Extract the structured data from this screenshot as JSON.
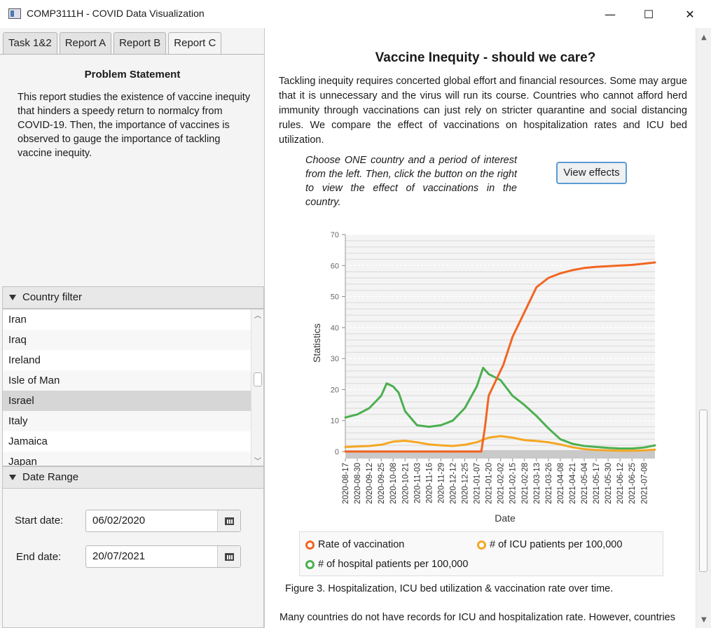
{
  "window": {
    "title": "COMP3111H - COVID Data Visualization",
    "minimize_glyph": "—",
    "maximize_glyph": "☐",
    "close_glyph": "✕"
  },
  "tabs": [
    "Task 1&2",
    "Report A",
    "Report B",
    "Report C"
  ],
  "active_tab": "Report C",
  "left": {
    "problem_title": "Problem Statement",
    "problem_text": "This report studies the existence of vaccine inequity that hinders a speedy return to normalcy from COVID-19. Then, the importance of vaccines is observed to gauge the importance of tackling vaccine inequity.",
    "country_filter": {
      "title": "Country filter",
      "items": [
        "Iran",
        "Iraq",
        "Ireland",
        "Isle of Man",
        "Israel",
        "Italy",
        "Jamaica",
        "Japan"
      ],
      "selected": "Israel"
    },
    "date_range": {
      "title": "Date Range",
      "start_label": "Start date:",
      "start_value": "06/02/2020",
      "end_label": "End date:",
      "end_value": "20/07/2021"
    }
  },
  "right": {
    "title": "Vaccine Inequity - should we care?",
    "paragraph": "Tackling inequity requires concerted global effort and financial resources. Some may argue that it is unnecessary and the virus will run its course. Countries who cannot afford herd immunity through vaccinations can just rely on stricter quarantine and social distancing rules. We compare the effect of vaccinations on hospitalization rates and ICU bed utilization.",
    "instruction": "Choose ONE country and a period of interest from the left. Then, click the button on the right to view the effect of vaccinations in the country.",
    "button_label": "View effects",
    "caption": "Figure 3. Hospitalization, ICU bed utilization & vaccination rate over time.",
    "bottom_text": "Many countries do not have records for ICU and hospitalization rate. However, countries"
  },
  "chart_data": {
    "type": "line",
    "xlabel": "Date",
    "ylabel": "Statistics",
    "ylim": [
      0,
      70
    ],
    "yticks": [
      0,
      10,
      20,
      30,
      40,
      50,
      60,
      70
    ],
    "grid": true,
    "legend_position": "bottom",
    "x_tick_labels": [
      "2020-08-17",
      "2020-08-30",
      "2020-09-12",
      "2020-09-25",
      "2020-10-08",
      "2020-10-21",
      "2020-11-03",
      "2020-11-16",
      "2020-11-29",
      "2020-12-12",
      "2020-12-25",
      "2021-01-07",
      "2021-01-20",
      "2021-02-02",
      "2021-02-15",
      "2021-02-28",
      "2021-03-13",
      "2021-03-26",
      "2021-04-08",
      "2021-04-21",
      "2021-05-04",
      "2021-05-17",
      "2021-05-30",
      "2021-06-12",
      "2021-06-25",
      "2021-07-08"
    ],
    "x_range": [
      "2020-08-17",
      "2021-07-20"
    ],
    "series": [
      {
        "name": "Rate of vaccination",
        "color": "#f26522",
        "points": [
          [
            "2020-08-17",
            0
          ],
          [
            "2020-12-25",
            0
          ],
          [
            "2021-01-12",
            0
          ],
          [
            "2021-01-16",
            8
          ],
          [
            "2021-01-20",
            18
          ],
          [
            "2021-01-28",
            23
          ],
          [
            "2021-02-05",
            28
          ],
          [
            "2021-02-15",
            37
          ],
          [
            "2021-02-28",
            45
          ],
          [
            "2021-03-13",
            53
          ],
          [
            "2021-03-26",
            56
          ],
          [
            "2021-04-08",
            57.5
          ],
          [
            "2021-04-21",
            58.5
          ],
          [
            "2021-05-04",
            59.2
          ],
          [
            "2021-05-17",
            59.6
          ],
          [
            "2021-05-30",
            59.8
          ],
          [
            "2021-06-12",
            60
          ],
          [
            "2021-06-25",
            60.2
          ],
          [
            "2021-07-08",
            60.6
          ],
          [
            "2021-07-20",
            61
          ]
        ]
      },
      {
        "name": "# of ICU patients per 100,000",
        "color": "#f5a623",
        "points": [
          [
            "2020-08-17",
            1.5
          ],
          [
            "2020-09-12",
            1.8
          ],
          [
            "2020-09-25",
            2.2
          ],
          [
            "2020-10-08",
            3.2
          ],
          [
            "2020-10-21",
            3.5
          ],
          [
            "2020-11-03",
            3
          ],
          [
            "2020-11-16",
            2.3
          ],
          [
            "2020-11-29",
            2
          ],
          [
            "2020-12-12",
            1.8
          ],
          [
            "2020-12-25",
            2.2
          ],
          [
            "2021-01-07",
            3
          ],
          [
            "2021-01-20",
            4.5
          ],
          [
            "2021-02-02",
            5
          ],
          [
            "2021-02-15",
            4.5
          ],
          [
            "2021-02-28",
            3.7
          ],
          [
            "2021-03-13",
            3.4
          ],
          [
            "2021-03-26",
            3
          ],
          [
            "2021-04-08",
            2.3
          ],
          [
            "2021-04-21",
            1.4
          ],
          [
            "2021-05-04",
            0.8
          ],
          [
            "2021-05-17",
            0.5
          ],
          [
            "2021-05-30",
            0.4
          ],
          [
            "2021-06-12",
            0.3
          ],
          [
            "2021-06-25",
            0.3
          ],
          [
            "2021-07-08",
            0.4
          ],
          [
            "2021-07-20",
            0.6
          ]
        ]
      },
      {
        "name": "# of hospital patients per 100,000",
        "color": "#4caf50",
        "points": [
          [
            "2020-08-17",
            11
          ],
          [
            "2020-08-30",
            12
          ],
          [
            "2020-09-12",
            14
          ],
          [
            "2020-09-25",
            18
          ],
          [
            "2020-10-01",
            22
          ],
          [
            "2020-10-08",
            21
          ],
          [
            "2020-10-14",
            19
          ],
          [
            "2020-10-21",
            13
          ],
          [
            "2020-11-03",
            8.5
          ],
          [
            "2020-11-16",
            8
          ],
          [
            "2020-11-29",
            8.5
          ],
          [
            "2020-12-12",
            10
          ],
          [
            "2020-12-25",
            14
          ],
          [
            "2021-01-07",
            21
          ],
          [
            "2021-01-14",
            27
          ],
          [
            "2021-01-20",
            25
          ],
          [
            "2021-02-02",
            23
          ],
          [
            "2021-02-15",
            18
          ],
          [
            "2021-02-28",
            15
          ],
          [
            "2021-03-13",
            11.5
          ],
          [
            "2021-03-26",
            7.5
          ],
          [
            "2021-04-08",
            4
          ],
          [
            "2021-04-21",
            2.5
          ],
          [
            "2021-05-04",
            1.8
          ],
          [
            "2021-05-17",
            1.5
          ],
          [
            "2021-05-30",
            1.2
          ],
          [
            "2021-06-12",
            1
          ],
          [
            "2021-06-25",
            1
          ],
          [
            "2021-07-08",
            1.3
          ],
          [
            "2021-07-20",
            2
          ]
        ]
      }
    ]
  }
}
